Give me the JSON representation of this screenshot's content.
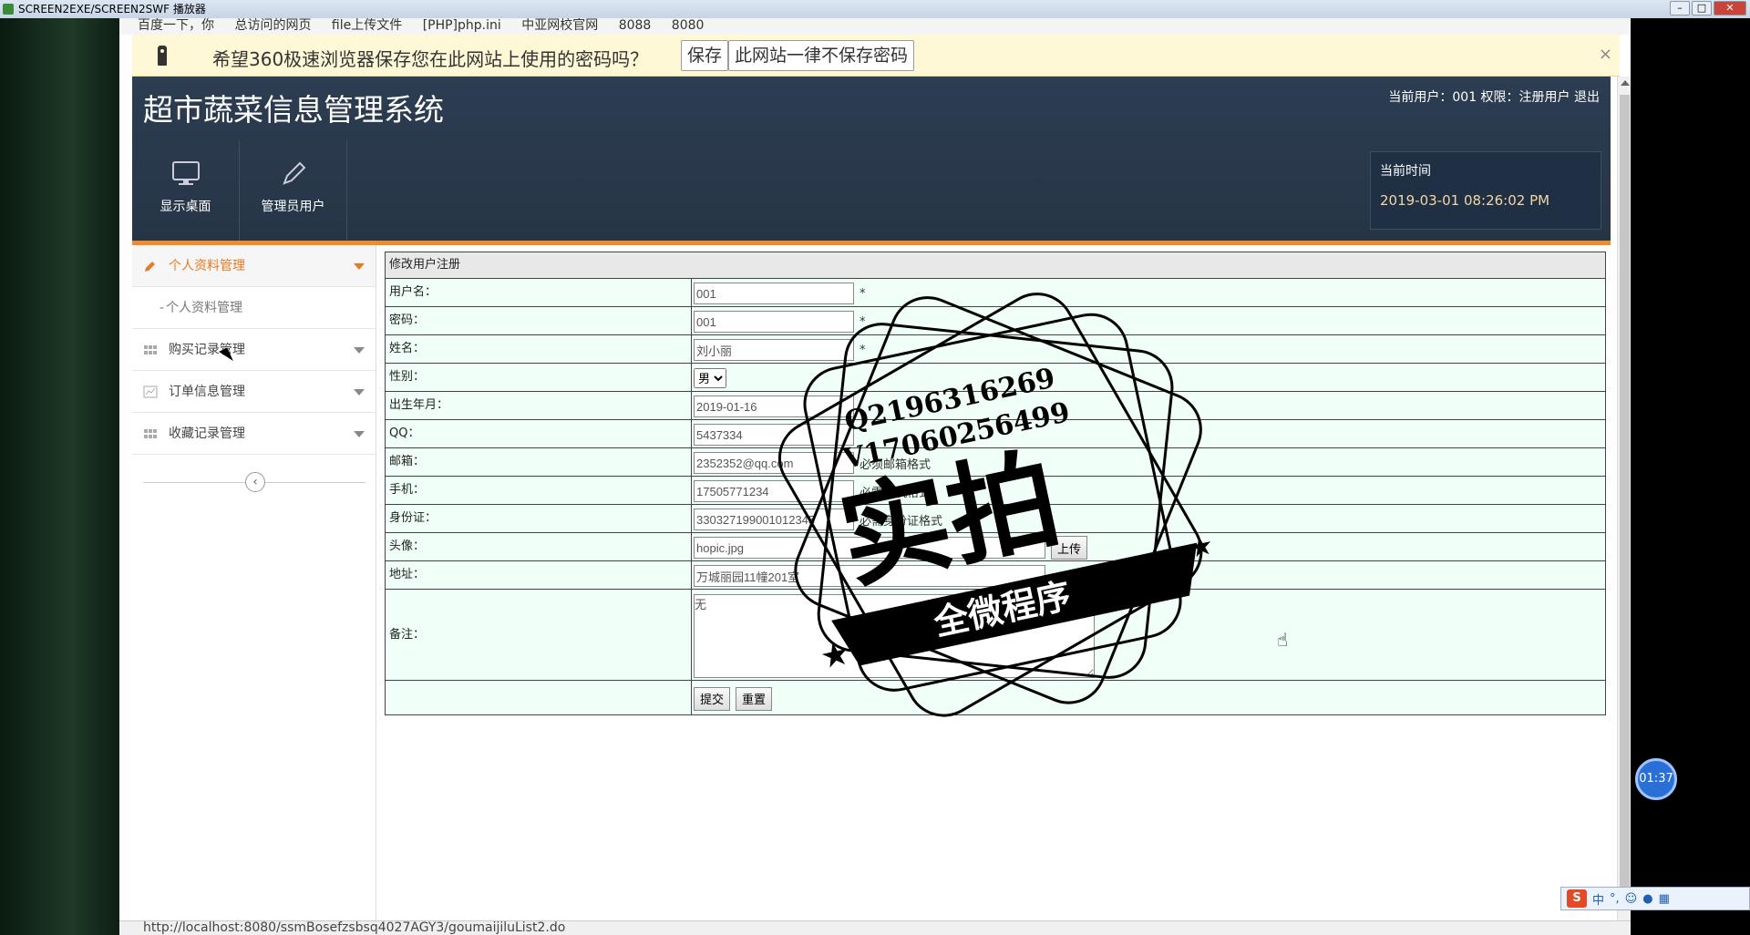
{
  "window": {
    "title": "SCREEN2EXE/SCREEN2SWF 播放器"
  },
  "bookmarks": [
    "百度一下，你",
    "总访问的网页",
    "file上传文件",
    "[PHP]php.ini",
    "中亚网校官网",
    "8088",
    "8080"
  ],
  "savebar": {
    "message": "希望360极速浏览器保存您在此网站上使用的密码吗？",
    "save_label": "保存",
    "never_label": "此网站一律不保存密码",
    "close": "×"
  },
  "header": {
    "title": "超市蔬菜信息管理系统",
    "user_info": "当前用户：001 权限：注册用户",
    "logout": "退出",
    "nav": [
      {
        "label": "显示桌面",
        "icon": "monitor-icon"
      },
      {
        "label": "管理员用户",
        "icon": "pencil-icon"
      }
    ],
    "time_label": "当前时间",
    "time_value": "2019-03-01 08:26:02 PM"
  },
  "sidebar": {
    "groups": [
      {
        "label": "个人资料管理",
        "icon": "pencil-icon",
        "active": true,
        "children": [
          "个人资料管理"
        ]
      },
      {
        "label": "购买记录管理",
        "icon": "grid-icon",
        "active": false,
        "children": []
      },
      {
        "label": "订单信息管理",
        "icon": "chart-icon",
        "active": false,
        "children": []
      },
      {
        "label": "收藏记录管理",
        "icon": "grid-icon",
        "active": false,
        "children": []
      }
    ],
    "collapse": "‹"
  },
  "form": {
    "caption": "修改用户注册",
    "fields": [
      {
        "label": "用户名：",
        "value": "001",
        "hint": "*"
      },
      {
        "label": "密码：",
        "value": "001",
        "hint": "*"
      },
      {
        "label": "姓名：",
        "value": "刘小丽",
        "hint": "*"
      },
      {
        "label": "性别：",
        "value": "男"
      },
      {
        "label": "出生年月：",
        "value": "2019-01-16"
      },
      {
        "label": "QQ：",
        "value": "5437334"
      },
      {
        "label": "邮箱：",
        "value": "2352352@qq.com",
        "hint": "必须邮箱格式"
      },
      {
        "label": "手机：",
        "value": "17505771234",
        "hint": "必需手机格式"
      },
      {
        "label": "身份证：",
        "value": "330327199001012345",
        "hint": "必需身份证格式"
      },
      {
        "label": "头像：",
        "value": "hopic.jpg",
        "button": "上传"
      },
      {
        "label": "地址：",
        "value": "万城丽园11幢201室"
      }
    ],
    "remark_label": "备注：",
    "remark_value": "无",
    "submit": "提交",
    "reset": "重置"
  },
  "watermark": {
    "line1": "Q2196316269",
    "line2": "V17060256499",
    "big": "实拍",
    "banner": "全微程序"
  },
  "statusbar": "http://localhost:8080/ssmBosefzsbsq4027AGY3/goumaijiluList2.do",
  "timer": "01:37",
  "ime": "中"
}
